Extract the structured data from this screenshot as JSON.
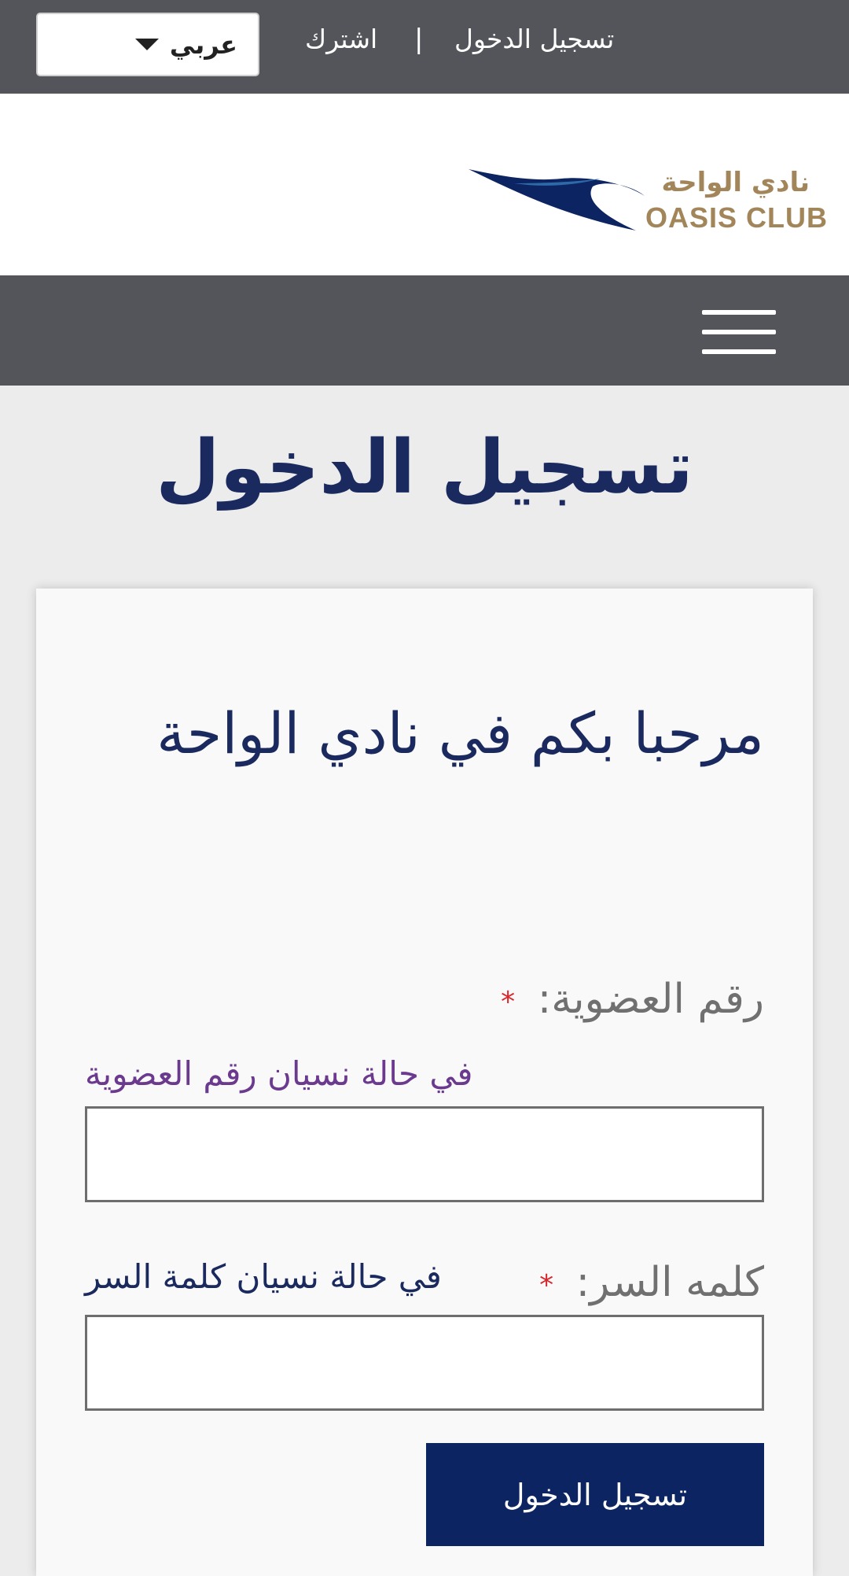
{
  "topbar": {
    "language": "عربي",
    "signup_link": "اشترك",
    "separator": "|",
    "login_link": "تسجيل الدخول"
  },
  "logo": {
    "arabic_name": "نادي الواحة",
    "english_name": "OASIS CLUB",
    "brand_color": "#a2865a",
    "swoosh_color": "#0c2461"
  },
  "page": {
    "title": "تسجيل الدخول"
  },
  "form": {
    "welcome": "مرحبا بكم في نادي الواحة",
    "membership_label": "رقم العضوية:",
    "membership_forgot": "في حالة نسيان رقم العضوية",
    "membership_value": "",
    "password_label": "كلمه السر:",
    "password_forgot": "في حالة نسيان كلمة السر",
    "password_value": "",
    "required_mark": "*",
    "submit_label": "تسجيل الدخول"
  },
  "colors": {
    "topbar_bg": "#54555a",
    "title": "#1b2a5e",
    "button_bg": "#0c2461",
    "required": "#d9262b",
    "forgot_member": "#6b3a8f"
  }
}
